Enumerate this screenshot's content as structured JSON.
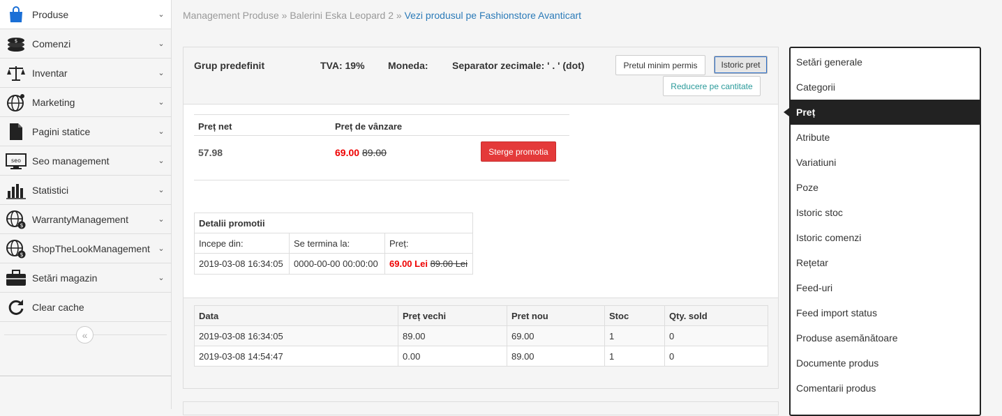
{
  "sidebar": {
    "items": [
      {
        "label": "Produse",
        "icon": "shopping-bag-icon"
      },
      {
        "label": "Comenzi",
        "icon": "coins-icon"
      },
      {
        "label": "Inventar",
        "icon": "scales-icon"
      },
      {
        "label": "Marketing",
        "icon": "globe-icon"
      },
      {
        "label": "Pagini statice",
        "icon": "document-icon"
      },
      {
        "label": "Seo management",
        "icon": "seo-monitor-icon"
      },
      {
        "label": "Statistici",
        "icon": "bar-chart-icon"
      },
      {
        "label": "WarrantyManagement",
        "icon": "globe-dollar-icon"
      },
      {
        "label": "ShopTheLookManagement",
        "icon": "globe-dollar-icon"
      },
      {
        "label": "Setări magazin",
        "icon": "briefcase-icon"
      },
      {
        "label": "Clear cache",
        "icon": "refresh-icon"
      }
    ],
    "collapse_glyph": "«"
  },
  "breadcrumb": {
    "part1": "Management Produse",
    "sep1": " » ",
    "part2": "Balerini Eska Leopard 2",
    "sep2": " » ",
    "link": "Vezi produsul pe Fashionstore Avanticart"
  },
  "header": {
    "group": "Grup predefinit",
    "vat": "TVA: 19%",
    "currency": "Moneda:",
    "separator": "Separator zecimale: ' . ' (dot)",
    "btn_min_price": "Pretul minim permis",
    "btn_price_history": "Istoric pret",
    "btn_qty_discount": "Reducere pe cantitate"
  },
  "price": {
    "col_net": "Preț net",
    "col_sale": "Preț de vânzare",
    "net_value": "57.98",
    "sale_new": "69.00",
    "sale_old": "89.00",
    "btn_delete_promo": "Sterge promotia"
  },
  "promo": {
    "title": "Detalii promotii",
    "col_start": "Incepe din:",
    "col_end": "Se termina la:",
    "col_price": "Preț:",
    "start": "2019-03-08 16:34:05",
    "end": "0000-00-00 00:00:00",
    "price_new": "69.00 Lei",
    "price_old": "89.00 Lei"
  },
  "history": {
    "headers": [
      "Data",
      "Preț vechi",
      "Pret nou",
      "Stoc",
      "Qty. sold"
    ],
    "rows": [
      [
        "2019-03-08 16:34:05",
        "89.00",
        "69.00",
        "1",
        "0"
      ],
      [
        "2019-03-08 14:54:47",
        "0.00",
        "89.00",
        "1",
        "0"
      ]
    ]
  },
  "right_nav": {
    "items": [
      "Setări generale",
      "Categorii",
      "Preț",
      "Atribute",
      "Variatiuni",
      "Poze",
      "Istoric stoc",
      "Istoric comenzi",
      "Rețetar",
      "Feed-uri",
      "Feed import status",
      "Produse asemănătoare",
      "Documente produs",
      "Comentarii produs"
    ],
    "active_index": 2
  },
  "colors": {
    "accent_link": "#2a7ab8",
    "danger": "#e43a3a",
    "price_red": "#e00000",
    "nav_active_bg": "#222222",
    "teal": "#2a9a9a"
  }
}
